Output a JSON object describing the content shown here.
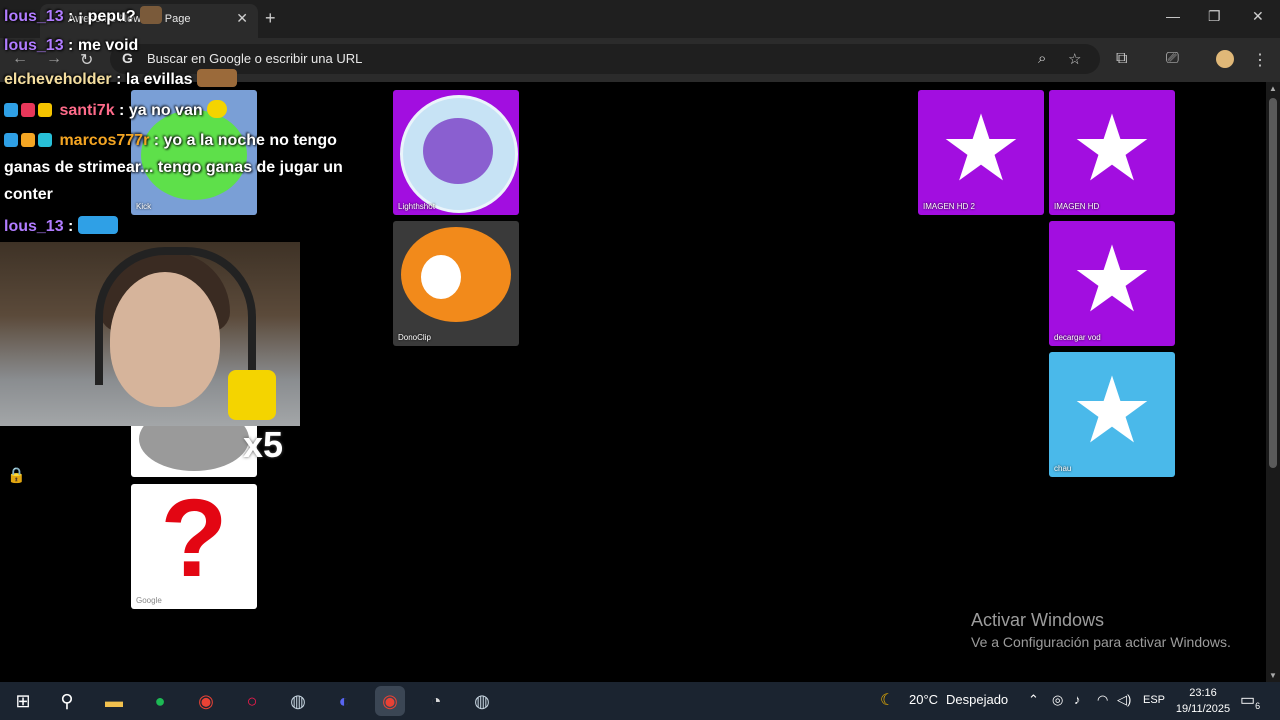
{
  "browser": {
    "tab_title": "Awesome New Tab Page",
    "new_tab_symbol": "+",
    "close_symbol": "✕",
    "window": {
      "minimize": "—",
      "restore": "❐",
      "close": "✕"
    },
    "omnibox": {
      "g": "G",
      "placeholder": "Buscar en Google o escribir una URL"
    },
    "icons": [
      "back-icon",
      "forward-icon",
      "reload-icon",
      "zoom-icon",
      "bookmark-star-icon",
      "extensions-icon",
      "cast-icon",
      "profile-icon",
      "menu-icon"
    ]
  },
  "tiles": [
    {
      "label": "Lighthshot",
      "color": "#a20ee0"
    },
    {
      "label": "DonoClip",
      "color": "#3a3a3a"
    },
    {
      "label": "IMAGEN HD 2",
      "color": "#a20ee0",
      "icon": "★"
    },
    {
      "label": "IMAGEN HD",
      "color": "#a20ee0",
      "icon": "★"
    },
    {
      "label": "decargar vod",
      "color": "#a20ee0",
      "icon": "★"
    },
    {
      "label": "chau",
      "color": "#4ab9ea",
      "icon": "★"
    },
    {
      "label": "Kick",
      "color": "#7a9fd6"
    },
    {
      "label": "Google",
      "color": "#ffffff",
      "icon": "?"
    }
  ],
  "chat": [
    {
      "user": "lous_13",
      "user_color": "#b07cff",
      "message": ": ¡ pepu?"
    },
    {
      "user": "lous_13",
      "user_color": "#b07cff",
      "message": ": me void"
    },
    {
      "user": "elcheveholder",
      "user_color": "#f5dfa0",
      "message": ": la evillas"
    },
    {
      "user": "santi7k",
      "user_color": "#ff6b8a",
      "message": ": ya no van"
    },
    {
      "user": "marcos777r",
      "user_color": "#f5a623",
      "message": ": yo a la noche no tengo ganas de strimear... tengo ganas de jugar un conter"
    },
    {
      "user": "lous_13",
      "user_color": "#b07cff",
      "message": ":"
    }
  ],
  "emote_overlay_text": "x5",
  "activate_windows": {
    "title": "Activar Windows",
    "subtitle": "Ve a Configuración para activar Windows."
  },
  "taskbar": {
    "weather_temp": "20°C",
    "weather_desc": "Despejado",
    "language": "ESP",
    "time": "23:16",
    "date": "19/11/2025",
    "notification_count": "6",
    "apps": [
      "windows-start-icon",
      "search-icon",
      "file-explorer-icon",
      "spotify-icon",
      "chrome-icon",
      "opera-gx-icon",
      "steam-icon",
      "discord-icon",
      "chrome-active-icon",
      "speedometer-icon",
      "steam-helper-icon"
    ]
  }
}
